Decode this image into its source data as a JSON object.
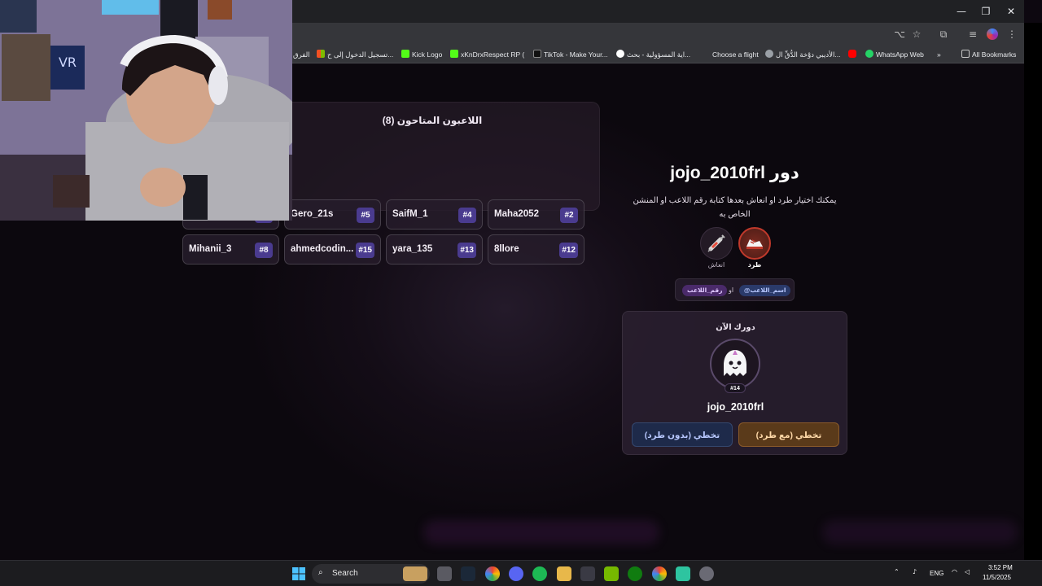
{
  "browser": {
    "window_controls": [
      "—",
      "❐",
      "✕"
    ],
    "bookmarks": [
      "الفرق",
      "تسجيل الدخول إلى ح...",
      "Kick Logo",
      "xKnDrxRespect RP (...",
      "TikTok - Make Your...",
      "اية المسؤولية - بحث...",
      "Choose a flight",
      "الأديبي دوْخة الدُّقِّ ال...",
      "WhatsApp Web"
    ],
    "bookmarks_more": "»",
    "all_bookmarks": "All Bookmarks"
  },
  "players_panel": {
    "title": "اللاعبون المتاحون (8)",
    "players": [
      {
        "name": "Maha2052",
        "number": "#2"
      },
      {
        "name": "SaifM_1",
        "number": "#4"
      },
      {
        "name": "Gero_21s",
        "number": "#5"
      },
      {
        "name": "",
        "number": ""
      },
      {
        "name": "8llore",
        "number": "#12"
      },
      {
        "name": "yara_135",
        "number": "#13"
      },
      {
        "name": "ahmedcodin...",
        "number": "#15"
      },
      {
        "name": "Mihanii_3",
        "number": "#8"
      }
    ]
  },
  "turn": {
    "title": "دور jojo_2010frl",
    "description": "يمكنك اختيار طرد او انعاش بعدها كتابة رقم اللاعب او المنشن الخاص به",
    "actions": [
      {
        "label": "طرد",
        "icon": "sneaker-icon"
      },
      {
        "label": "انعاش",
        "icon": "syringe-icon"
      }
    ],
    "hint": {
      "mention": "@اسم_اللاعب",
      "or": "او",
      "number": "رقم_اللاعب"
    },
    "now_label": "دورك الآن",
    "current_player": {
      "name": "jojo_2010frl",
      "number": "#14",
      "avatar": "ghost-icon"
    },
    "buttons": {
      "skip_with_kick": "تخطي (مع طرد)",
      "skip_without_kick": "تخطي (بدون طرد)"
    }
  },
  "taskbar": {
    "search": "Search",
    "language": "ENG",
    "time": "3:52 PM",
    "date": "11/5/2025"
  },
  "colors": {
    "accent_purple": "#4a3b8f",
    "kick_red": "#c0392b",
    "skip_with_kick": "#5a3a1a",
    "skip_without_kick": "#1e2a4a"
  }
}
